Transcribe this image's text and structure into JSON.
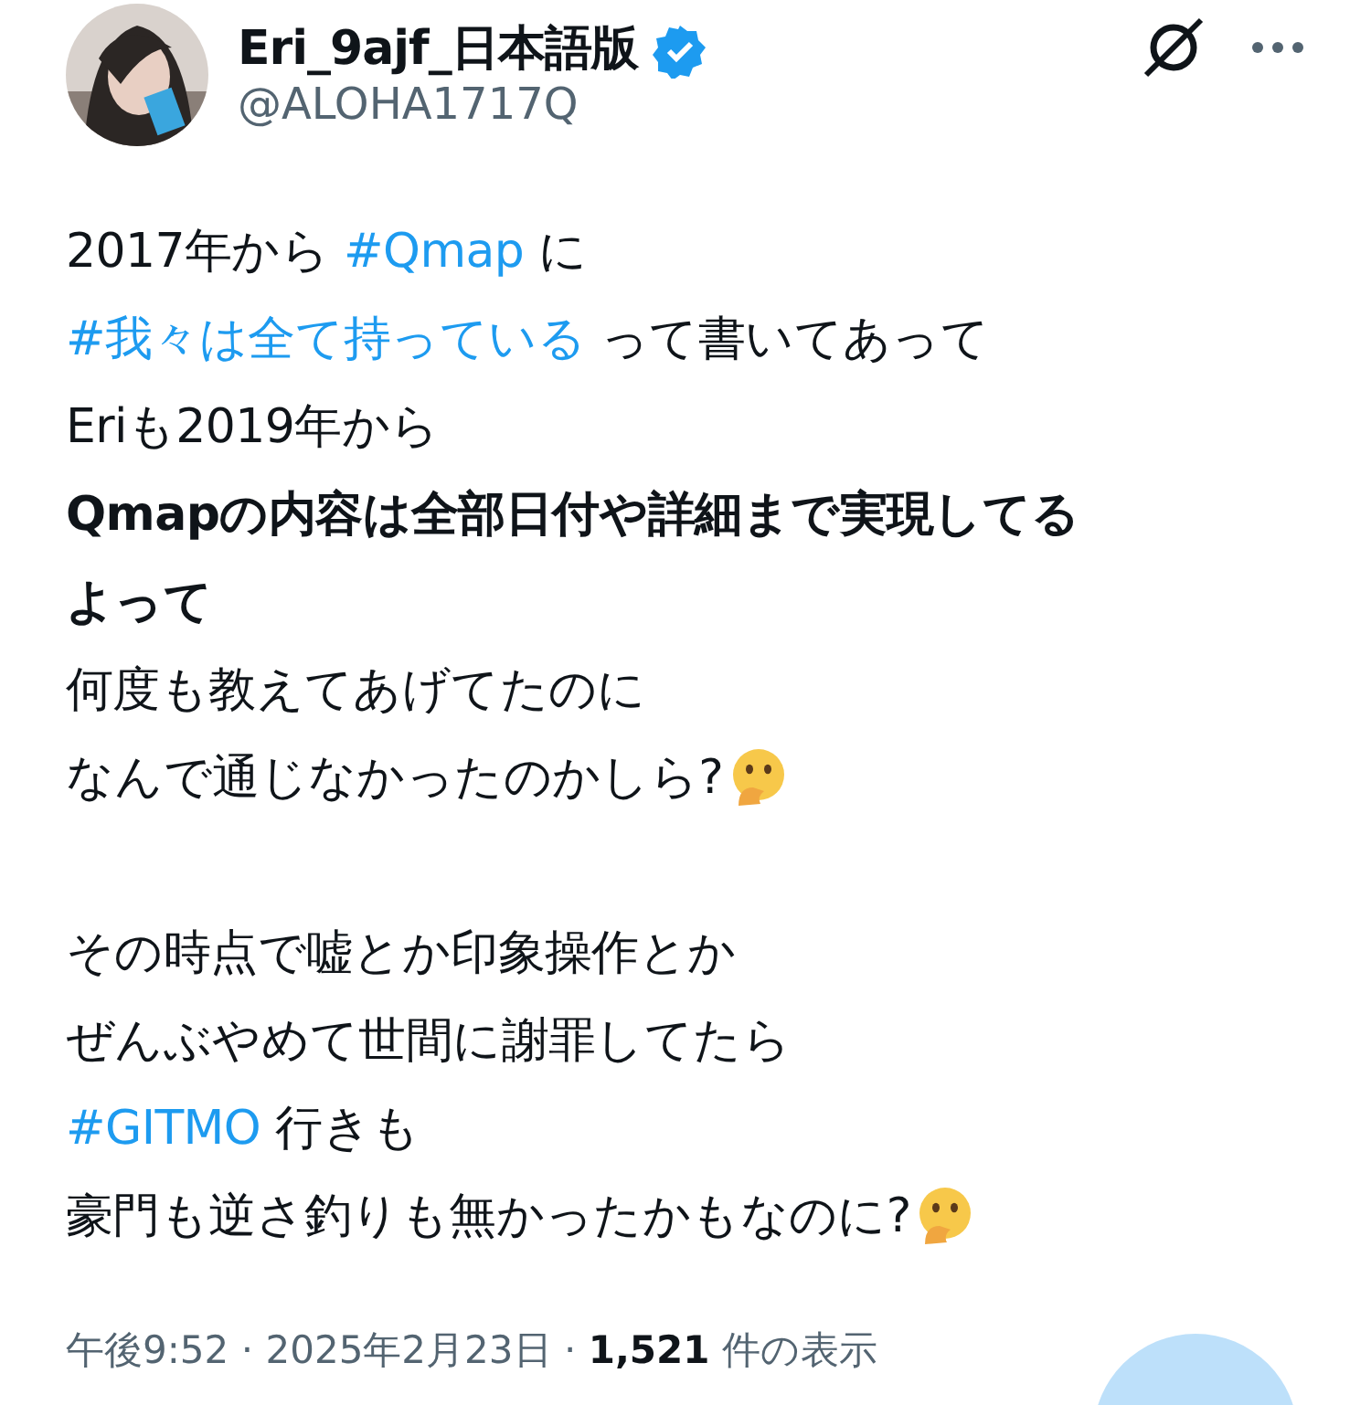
{
  "author": {
    "name": "Eri_9ajf_日本語版",
    "verified": true,
    "handle": "@ALOHA1717Q"
  },
  "paragraphs": [
    [
      {
        "segments": [
          {
            "kind": "text",
            "text": "2017年から "
          },
          {
            "kind": "hashtag",
            "text": "#Qmap"
          },
          {
            "kind": "text",
            "text": " に"
          }
        ]
      },
      {
        "segments": [
          {
            "kind": "hashtag",
            "text": "#我々は全て持っている"
          },
          {
            "kind": "text",
            "text": " って書いてあって"
          }
        ]
      },
      {
        "segments": [
          {
            "kind": "text",
            "text": "Eriも2019年から"
          }
        ]
      },
      {
        "segments": [
          {
            "kind": "bold",
            "text": "Qmapの内容は全部日付や詳細まで実現してる"
          }
        ]
      },
      {
        "segments": [
          {
            "kind": "bold",
            "text": "よって"
          }
        ]
      },
      {
        "segments": [
          {
            "kind": "text",
            "text": "何度も教えてあげてたのに"
          }
        ]
      },
      {
        "segments": [
          {
            "kind": "text",
            "text": "なんで通じなかったのかしら?"
          },
          {
            "kind": "emoji"
          }
        ]
      }
    ],
    [
      {
        "segments": [
          {
            "kind": "text",
            "text": "その時点で嘘とか印象操作とか"
          }
        ]
      },
      {
        "segments": [
          {
            "kind": "text",
            "text": "ぜんぶやめて世間に謝罪してたら"
          }
        ]
      },
      {
        "segments": [
          {
            "kind": "hashtag",
            "text": "#GITMO"
          },
          {
            "kind": "text",
            "text": " 行きも"
          }
        ]
      },
      {
        "segments": [
          {
            "kind": "text",
            "text": "豪門も逆さ釣りも無かったかもなのに?"
          },
          {
            "kind": "emoji"
          }
        ]
      }
    ]
  ],
  "meta": {
    "time": "午後9:52",
    "separator_1": "·",
    "date": "2025年2月23日",
    "separator_2": "·",
    "views": "1,521",
    "views_label": "件の表示"
  }
}
